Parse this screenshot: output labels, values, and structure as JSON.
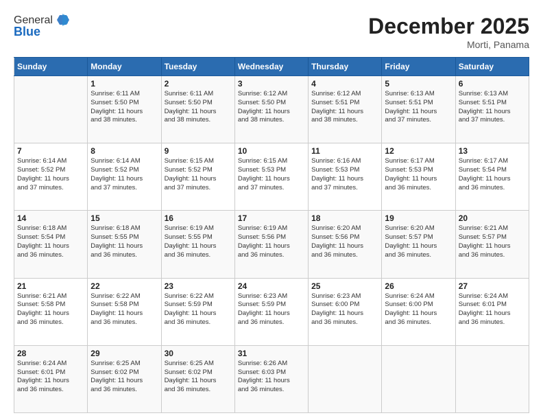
{
  "header": {
    "logo_line1": "General",
    "logo_line2": "Blue",
    "month": "December 2025",
    "location": "Morti, Panama"
  },
  "weekdays": [
    "Sunday",
    "Monday",
    "Tuesday",
    "Wednesday",
    "Thursday",
    "Friday",
    "Saturday"
  ],
  "weeks": [
    [
      {
        "day": "",
        "info": ""
      },
      {
        "day": "1",
        "info": "Sunrise: 6:11 AM\nSunset: 5:50 PM\nDaylight: 11 hours\nand 38 minutes."
      },
      {
        "day": "2",
        "info": "Sunrise: 6:11 AM\nSunset: 5:50 PM\nDaylight: 11 hours\nand 38 minutes."
      },
      {
        "day": "3",
        "info": "Sunrise: 6:12 AM\nSunset: 5:50 PM\nDaylight: 11 hours\nand 38 minutes."
      },
      {
        "day": "4",
        "info": "Sunrise: 6:12 AM\nSunset: 5:51 PM\nDaylight: 11 hours\nand 38 minutes."
      },
      {
        "day": "5",
        "info": "Sunrise: 6:13 AM\nSunset: 5:51 PM\nDaylight: 11 hours\nand 37 minutes."
      },
      {
        "day": "6",
        "info": "Sunrise: 6:13 AM\nSunset: 5:51 PM\nDaylight: 11 hours\nand 37 minutes."
      }
    ],
    [
      {
        "day": "7",
        "info": "Sunrise: 6:14 AM\nSunset: 5:52 PM\nDaylight: 11 hours\nand 37 minutes."
      },
      {
        "day": "8",
        "info": "Sunrise: 6:14 AM\nSunset: 5:52 PM\nDaylight: 11 hours\nand 37 minutes."
      },
      {
        "day": "9",
        "info": "Sunrise: 6:15 AM\nSunset: 5:52 PM\nDaylight: 11 hours\nand 37 minutes."
      },
      {
        "day": "10",
        "info": "Sunrise: 6:15 AM\nSunset: 5:53 PM\nDaylight: 11 hours\nand 37 minutes."
      },
      {
        "day": "11",
        "info": "Sunrise: 6:16 AM\nSunset: 5:53 PM\nDaylight: 11 hours\nand 37 minutes."
      },
      {
        "day": "12",
        "info": "Sunrise: 6:17 AM\nSunset: 5:53 PM\nDaylight: 11 hours\nand 36 minutes."
      },
      {
        "day": "13",
        "info": "Sunrise: 6:17 AM\nSunset: 5:54 PM\nDaylight: 11 hours\nand 36 minutes."
      }
    ],
    [
      {
        "day": "14",
        "info": "Sunrise: 6:18 AM\nSunset: 5:54 PM\nDaylight: 11 hours\nand 36 minutes."
      },
      {
        "day": "15",
        "info": "Sunrise: 6:18 AM\nSunset: 5:55 PM\nDaylight: 11 hours\nand 36 minutes."
      },
      {
        "day": "16",
        "info": "Sunrise: 6:19 AM\nSunset: 5:55 PM\nDaylight: 11 hours\nand 36 minutes."
      },
      {
        "day": "17",
        "info": "Sunrise: 6:19 AM\nSunset: 5:56 PM\nDaylight: 11 hours\nand 36 minutes."
      },
      {
        "day": "18",
        "info": "Sunrise: 6:20 AM\nSunset: 5:56 PM\nDaylight: 11 hours\nand 36 minutes."
      },
      {
        "day": "19",
        "info": "Sunrise: 6:20 AM\nSunset: 5:57 PM\nDaylight: 11 hours\nand 36 minutes."
      },
      {
        "day": "20",
        "info": "Sunrise: 6:21 AM\nSunset: 5:57 PM\nDaylight: 11 hours\nand 36 minutes."
      }
    ],
    [
      {
        "day": "21",
        "info": "Sunrise: 6:21 AM\nSunset: 5:58 PM\nDaylight: 11 hours\nand 36 minutes."
      },
      {
        "day": "22",
        "info": "Sunrise: 6:22 AM\nSunset: 5:58 PM\nDaylight: 11 hours\nand 36 minutes."
      },
      {
        "day": "23",
        "info": "Sunrise: 6:22 AM\nSunset: 5:59 PM\nDaylight: 11 hours\nand 36 minutes."
      },
      {
        "day": "24",
        "info": "Sunrise: 6:23 AM\nSunset: 5:59 PM\nDaylight: 11 hours\nand 36 minutes."
      },
      {
        "day": "25",
        "info": "Sunrise: 6:23 AM\nSunset: 6:00 PM\nDaylight: 11 hours\nand 36 minutes."
      },
      {
        "day": "26",
        "info": "Sunrise: 6:24 AM\nSunset: 6:00 PM\nDaylight: 11 hours\nand 36 minutes."
      },
      {
        "day": "27",
        "info": "Sunrise: 6:24 AM\nSunset: 6:01 PM\nDaylight: 11 hours\nand 36 minutes."
      }
    ],
    [
      {
        "day": "28",
        "info": "Sunrise: 6:24 AM\nSunset: 6:01 PM\nDaylight: 11 hours\nand 36 minutes."
      },
      {
        "day": "29",
        "info": "Sunrise: 6:25 AM\nSunset: 6:02 PM\nDaylight: 11 hours\nand 36 minutes."
      },
      {
        "day": "30",
        "info": "Sunrise: 6:25 AM\nSunset: 6:02 PM\nDaylight: 11 hours\nand 36 minutes."
      },
      {
        "day": "31",
        "info": "Sunrise: 6:26 AM\nSunset: 6:03 PM\nDaylight: 11 hours\nand 36 minutes."
      },
      {
        "day": "",
        "info": ""
      },
      {
        "day": "",
        "info": ""
      },
      {
        "day": "",
        "info": ""
      }
    ]
  ]
}
